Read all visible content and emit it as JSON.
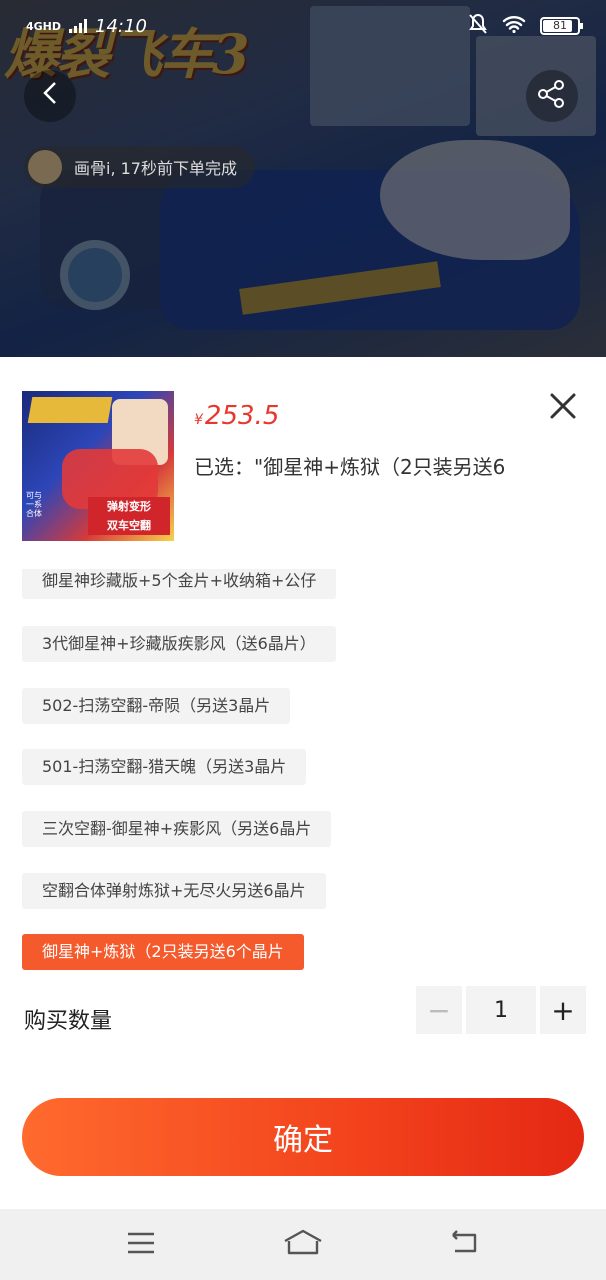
{
  "status_bar": {
    "network": "4GHD",
    "time": "14:10",
    "battery": "81"
  },
  "hero": {
    "logo_text": "爆裂飞车3",
    "order_toast": "画骨i, 17秒前下单完成"
  },
  "sheet": {
    "price_symbol": "¥",
    "price": "253.5",
    "selected_text": "已选：\"御星神+炼狱（2只装另送6",
    "thumbnail": {
      "tag_line1": "弹射变形",
      "tag_line2": "双车空翻",
      "side_text": "可与一系合体"
    },
    "options": [
      {
        "label": "御星神珍藏版+5个金片+收纳箱+公仔",
        "selected": false
      },
      {
        "label": "3代御星神+珍藏版疾影风（送6晶片）",
        "selected": false
      },
      {
        "label": "502-扫荡空翻-帝陨（另送3晶片",
        "selected": false
      },
      {
        "label": "501-扫荡空翻-猎天魄（另送3晶片",
        "selected": false
      },
      {
        "label": "三次空翻-御星神+疾影风（另送6晶片",
        "selected": false
      },
      {
        "label": "空翻合体弹射炼狱+无尽火另送6晶片",
        "selected": false
      },
      {
        "label": "御星神+炼狱（2只装另送6个晶片",
        "selected": true
      }
    ],
    "quantity_label": "购买数量",
    "quantity": "1",
    "minus_label": "−",
    "plus_label": "+",
    "confirm_label": "确定"
  },
  "colors": {
    "accent": "#f45a2c",
    "price": "#e8382e",
    "confirm_start": "#ff6a2e",
    "confirm_end": "#e42814"
  }
}
